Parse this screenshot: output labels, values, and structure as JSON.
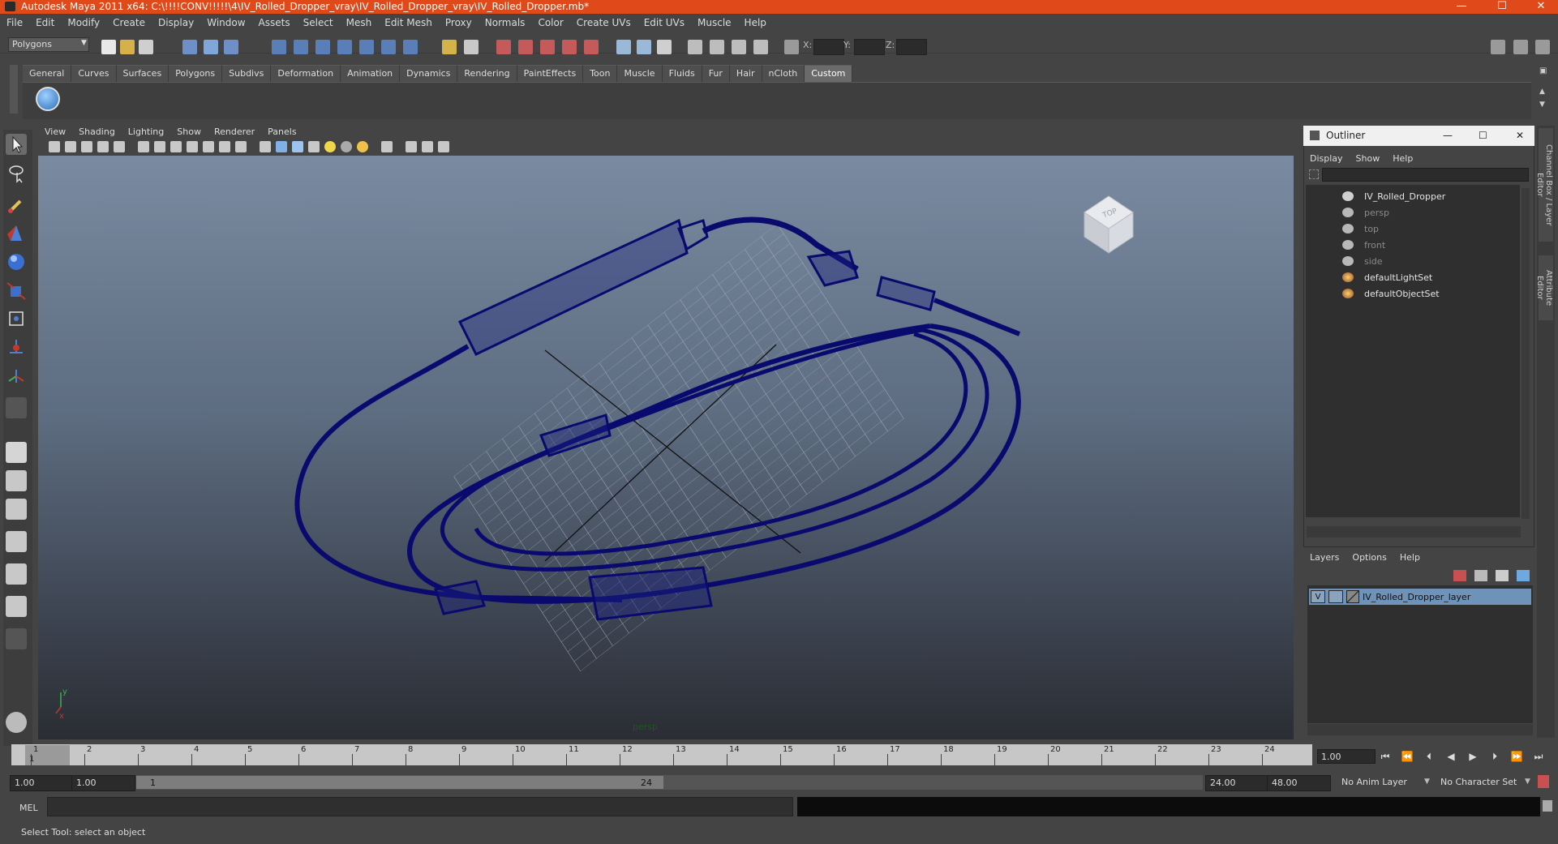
{
  "window": {
    "title": "Autodesk Maya 2011 x64: C:\\!!!!CONV!!!!!\\4\\IV_Rolled_Dropper_vray\\IV_Rolled_Dropper_vray\\IV_Rolled_Dropper.mb*",
    "minimize": "—",
    "maximize": "☐",
    "close": "✕"
  },
  "menubar": [
    "File",
    "Edit",
    "Modify",
    "Create",
    "Display",
    "Window",
    "Assets",
    "Select",
    "Mesh",
    "Edit Mesh",
    "Proxy",
    "Normals",
    "Color",
    "Create UVs",
    "Edit UVs",
    "Muscle",
    "Help"
  ],
  "statusline": {
    "mode": "Polygons",
    "x_label": "X:",
    "y_label": "Y:",
    "z_label": "Z:"
  },
  "shelf": {
    "tabs": [
      "General",
      "Curves",
      "Surfaces",
      "Polygons",
      "Subdivs",
      "Deformation",
      "Animation",
      "Dynamics",
      "Rendering",
      "PaintEffects",
      "Toon",
      "Muscle",
      "Fluids",
      "Fur",
      "Hair",
      "nCloth",
      "Custom"
    ],
    "active_tab": "Custom"
  },
  "viewport": {
    "menu": [
      "View",
      "Shading",
      "Lighting",
      "Show",
      "Renderer",
      "Panels"
    ],
    "camera_label": "persp",
    "viewcube_label": "TOP",
    "axis_y": "y",
    "axis_x": "x",
    "wire_color": "#0a0a6e"
  },
  "outliner": {
    "title": "Outliner",
    "menu": [
      "Display",
      "Show",
      "Help"
    ],
    "items": [
      {
        "name": "IV_Rolled_Dropper",
        "dim": false
      },
      {
        "name": "persp",
        "dim": true
      },
      {
        "name": "top",
        "dim": true
      },
      {
        "name": "front",
        "dim": true
      },
      {
        "name": "side",
        "dim": true
      },
      {
        "name": "defaultLightSet",
        "dim": false
      },
      {
        "name": "defaultObjectSet",
        "dim": false
      }
    ]
  },
  "layers": {
    "menu": [
      "Layers",
      "Options",
      "Help"
    ],
    "layer_visible": "V",
    "layer_name": "IV_Rolled_Dropper_layer",
    "selected_color": "#6f93b8"
  },
  "side_tabs": [
    "Channel Box / Layer Editor",
    "Attribute Editor"
  ],
  "timeline": {
    "frames": [
      "1",
      "2",
      "3",
      "4",
      "5",
      "6",
      "7",
      "8",
      "9",
      "10",
      "11",
      "12",
      "13",
      "14",
      "15",
      "16",
      "17",
      "18",
      "19",
      "20",
      "21",
      "22",
      "23",
      "24"
    ],
    "current_frame_marker": "1",
    "current_frame": "1.00",
    "playback_buttons": [
      "⏮",
      "⏪",
      "⏴",
      "◀",
      "▶",
      "⏵",
      "⏩",
      "⏭"
    ]
  },
  "range": {
    "start": "1.00",
    "playback_start": "1.00",
    "slider_start": "1",
    "slider_end": "24",
    "playback_end": "24.00",
    "end": "48.00",
    "anim_layer": "No Anim Layer",
    "character_set": "No Character Set"
  },
  "commandline": {
    "label": "MEL"
  },
  "helpline": "Select Tool: select an object"
}
